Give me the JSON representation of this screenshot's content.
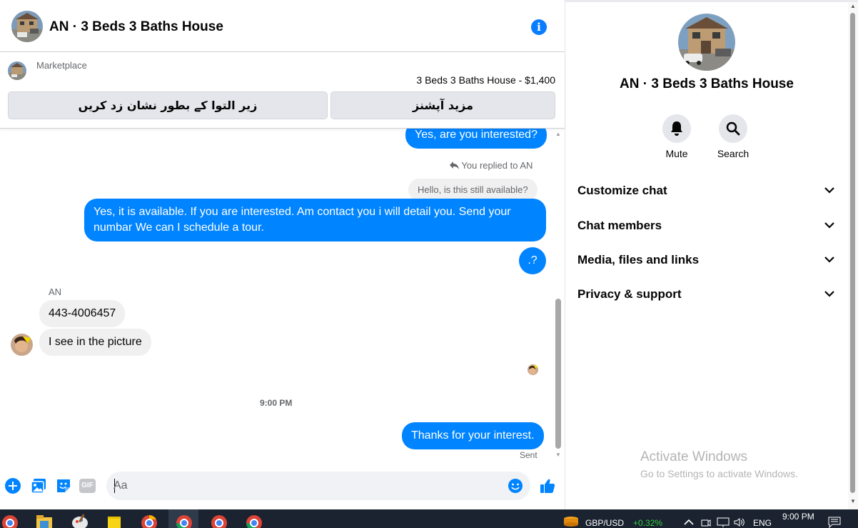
{
  "header": {
    "title": "AN · 3 Beds 3 Baths House"
  },
  "listing": {
    "source": "Marketplace",
    "price_line": "3 Beds 3 Baths House - $1,400",
    "mark_pending_label": "زیر التوا کے بطور نشان زد کریں",
    "more_options_label": "مزید آپشنز"
  },
  "messages": {
    "partial_top": "Yes, are you interested?",
    "reply_indicator": "You replied to AN",
    "quoted": "Hello, is this still available?",
    "outgoing_long": "Yes, it is available. If you are interested. Am contact you i will detail you. Send your numbar We can I schedule a tour.",
    "outgoing_short": ".?",
    "sender_name": "AN",
    "incoming_phone": "443-4006457",
    "incoming_picture": "I see in the picture",
    "time_separator": "9:00 PM",
    "outgoing_last": "Thanks for your interest.",
    "status": "Sent"
  },
  "composer": {
    "placeholder": "Aa",
    "gif_label": "GIF"
  },
  "details": {
    "title": "AN · 3 Beds 3 Baths House",
    "actions": [
      "Mute",
      "Search"
    ],
    "sections": [
      "Customize chat",
      "Chat members",
      "Media, files and links",
      "Privacy & support"
    ]
  },
  "watermark": {
    "line1": "Activate Windows",
    "line2": "Go to Settings to activate Windows."
  },
  "taskbar": {
    "ticker_pair": "GBP/USD",
    "ticker_change": "+0.32%",
    "language": "ENG",
    "clock_time": "9:00 PM"
  },
  "colors": {
    "accent": "#0084ff",
    "incoming_bubble": "#f0f0f0",
    "button_gray": "#e4e6eb",
    "ticker_positive": "#2ecc40"
  }
}
